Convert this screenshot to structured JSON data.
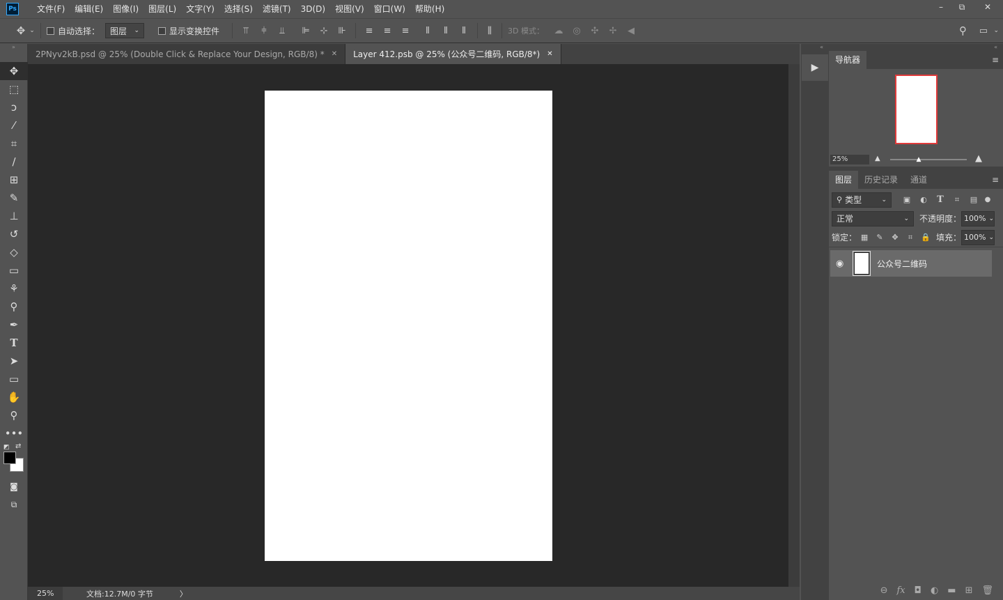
{
  "app": {
    "logo": "Ps"
  },
  "menu": [
    "文件(F)",
    "编辑(E)",
    "图像(I)",
    "图层(L)",
    "文字(Y)",
    "选择(S)",
    "滤镜(T)",
    "3D(D)",
    "视图(V)",
    "窗口(W)",
    "帮助(H)"
  ],
  "window_controls": {
    "minimize": "–",
    "restore": "⧉",
    "close": "✕"
  },
  "options": {
    "auto_select_label": "自动选择：",
    "auto_select_value": "图层",
    "show_transform_label": "显示变换控件",
    "mode_3d_label": "3D 模式："
  },
  "tabs": [
    {
      "label": "2PNyv2kB.psd @ 25% (Double Click & Replace Your Design, RGB/8) *",
      "close": "✕"
    },
    {
      "label": "Layer 412.psb @ 25% (公众号二维码, RGB/8*)",
      "close": "✕"
    }
  ],
  "status": {
    "zoom": "25%",
    "doc_info": "文档:12.7M/0 字节",
    "arrow": "〉"
  },
  "navigator": {
    "tab_label": "导航器",
    "zoom": "25%"
  },
  "layers_panel": {
    "tabs": [
      "图层",
      "历史记录",
      "通道"
    ],
    "filter_label": "类型",
    "blend_mode": "正常",
    "opacity_label": "不透明度：",
    "opacity_value": "100%",
    "lock_label": "锁定：",
    "fill_label": "填充：",
    "fill_value": "100%",
    "layers": [
      {
        "name": "公众号二维码",
        "visible": true
      }
    ]
  },
  "colors": {
    "foreground": "#000000",
    "background": "#ffffff",
    "accent": "#31a8ff"
  }
}
